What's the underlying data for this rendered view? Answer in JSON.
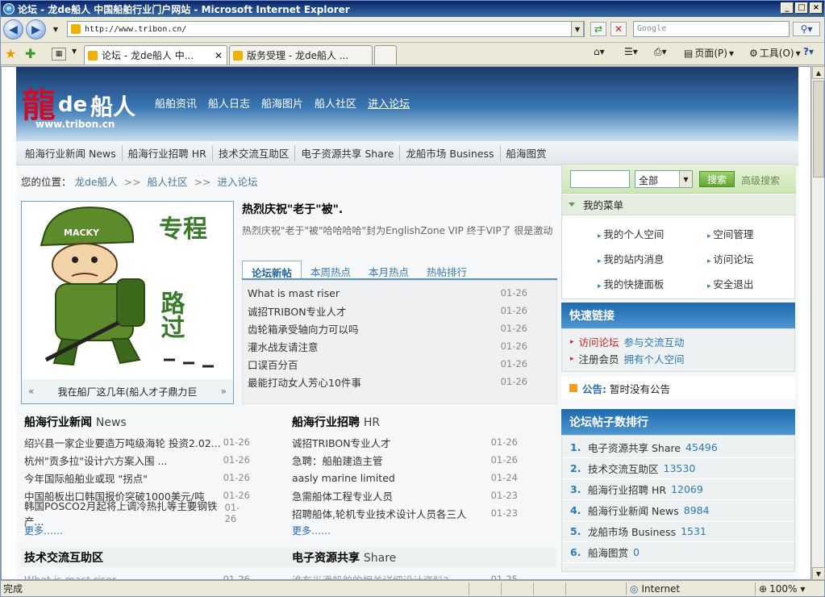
{
  "window": {
    "title": "论坛 - 龙de船人 中国船舶行业门户网站 - Microsoft Internet Explorer",
    "controls": [
      "_",
      "□",
      "×"
    ]
  },
  "address_bar": {
    "url": "http://www.tribon.cn/",
    "search_placeholder": "Google"
  },
  "tabs": [
    {
      "label": "论坛 - 龙de船人 中..."
    },
    {
      "label": "版务受理 - 龙de船人 ..."
    }
  ],
  "command_bar": {
    "page": "页面(P)",
    "tools": "工具(O)"
  },
  "status_bar": {
    "left": "完成",
    "zone": "Internet",
    "zoom": "100%"
  },
  "site": {
    "logo": {
      "char": "龍",
      "de": "de",
      "name": "船人",
      "url": "www.tribon.cn"
    },
    "top_nav": [
      "船舶资讯",
      "船人日志",
      "船海图片",
      "船人社区",
      "进入论坛"
    ],
    "sub_nav": [
      "船海行业新闻 News",
      "船海行业招聘 HR",
      "技术交流互助区",
      "电子资源共享 Share",
      "龙船市场 Business",
      "船海图赏"
    ],
    "breadcrumb": {
      "label": "您的位置：",
      "items": [
        "龙de船人",
        "船人社区",
        "进入论坛"
      ],
      "sep": ">>"
    },
    "featured": {
      "caption": "我在船厂这几年(船人才子鼎力巨",
      "prev": "«",
      "next": "»",
      "image_text": {
        "helmet": "MACKY",
        "title1": "专程",
        "title2": "路过"
      }
    },
    "headline": {
      "title": "热烈庆祝\"老于\"被\".",
      "desc": "热烈庆祝\"老于\"被\"哈哈哈哈\"封为EnglishZone VIP 终于VIP了 很是激动"
    },
    "forum_tabs": [
      "论坛新帖",
      "本周热点",
      "本月热点",
      "热帖排行"
    ],
    "forum_posts": [
      {
        "title": "What is mast riser",
        "date": "01-26"
      },
      {
        "title": "诚招TRIBON专业人才",
        "date": "01-26"
      },
      {
        "title": "齿轮箱承受轴向力可以吗",
        "date": "01-26"
      },
      {
        "title": "灌水战友请注意",
        "date": "01-26"
      },
      {
        "title": "口误百分百",
        "date": "01-26"
      },
      {
        "title": "最能打动女人芳心10件事",
        "date": "01-26"
      }
    ],
    "news": {
      "title": "船海行业新闻",
      "en": "News",
      "items": [
        {
          "title": "绍兴县一家企业要造万吨级海轮 投资2.02...",
          "date": "01-26"
        },
        {
          "title": "杭州\"贡多拉\"设计六方案入围 ...",
          "date": "01-26"
        },
        {
          "title": "今年国际船舶业或现 \"拐点\"",
          "date": "01-26"
        },
        {
          "title": "中国船板出口韩国报价突破1000美元/吨",
          "date": "01-26"
        },
        {
          "title": "韩国POSCO2月起将上调冷热扎等主要钢铁产...",
          "date": "01-26"
        }
      ],
      "more": "更多……"
    },
    "jobs": {
      "title": "船海行业招聘",
      "en": "HR",
      "items": [
        {
          "title": "诚招TRIBON专业人才",
          "date": "01-26"
        },
        {
          "title": "急聘：船舶建造主管",
          "date": "01-26"
        },
        {
          "title": "aasly marine limited",
          "date": "01-24"
        },
        {
          "title": "急需船体工程专业人员",
          "date": "01-23"
        },
        {
          "title": "招聘船体,轮机专业技术设计人员各三人",
          "date": "01-23"
        }
      ],
      "more": "更多……"
    },
    "tech": {
      "title": "技术交流互助区",
      "first": "What is mast riser",
      "date": "01-26"
    },
    "share": {
      "title": "电子资源共享",
      "en": "Share",
      "first": "谁有光滑船舶的相关详细设计资料?",
      "date": "01-25"
    },
    "search": {
      "select": "全部",
      "button": "搜索",
      "advanced": "高级搜索"
    },
    "my_menu": {
      "title": "我的菜单",
      "items": [
        "我的个人空间",
        "空间管理",
        "我的站内消息",
        "访问论坛",
        "我的快捷面板",
        "安全退出"
      ]
    },
    "quick_links": {
      "title": "快速链接",
      "items": [
        {
          "a": "访问论坛",
          "b": "参与交流互动"
        },
        {
          "a": "注册会员",
          "b": "拥有个人空间"
        }
      ]
    },
    "notice": {
      "label": "公告:",
      "text": "暂时没有公告"
    },
    "ranking": {
      "title": "论坛帖子数排行",
      "items": [
        {
          "n": "1.",
          "name": "电子资源共享 Share",
          "count": "45496"
        },
        {
          "n": "2.",
          "name": "技术交流互助区",
          "count": "13530"
        },
        {
          "n": "3.",
          "name": "船海行业招聘 HR",
          "count": "12069"
        },
        {
          "n": "4.",
          "name": "船海行业新闻 News",
          "count": "8984"
        },
        {
          "n": "5.",
          "name": "龙船市场 Business",
          "count": "1531"
        },
        {
          "n": "6.",
          "name": "船海图赏",
          "count": "0"
        }
      ]
    }
  }
}
